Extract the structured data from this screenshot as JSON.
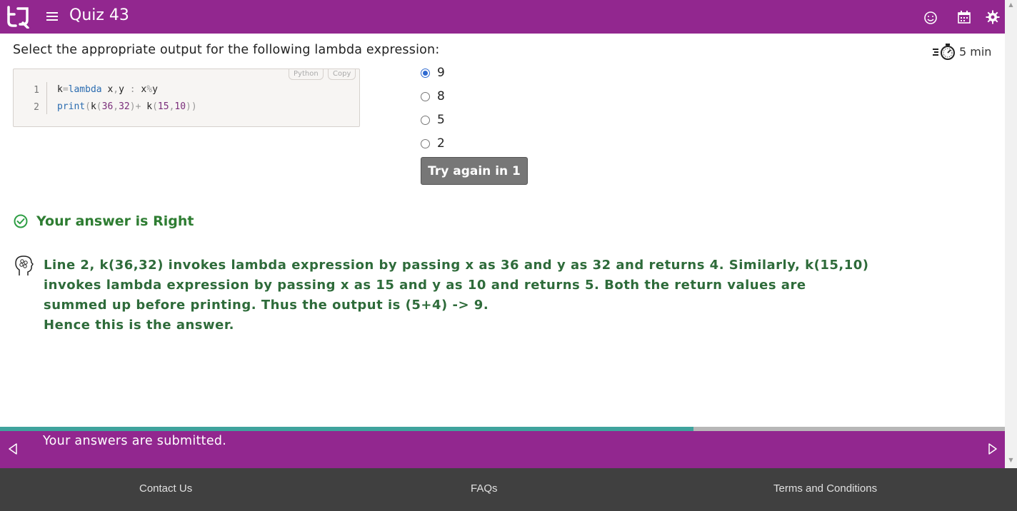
{
  "header": {
    "title": "Quiz 43",
    "icons": [
      "logo-icon",
      "menu-icon",
      "smiley-icon",
      "calendar-icon",
      "settings-icon"
    ]
  },
  "question": {
    "text": "Select the appropriate output for the following lambda expression:",
    "timer": "5 min"
  },
  "code": {
    "language_label": "Python",
    "copy_label": "Copy",
    "line_numbers": [
      "1",
      "2"
    ]
  },
  "options": [
    {
      "label": "9",
      "selected": true
    },
    {
      "label": "8",
      "selected": false
    },
    {
      "label": "5",
      "selected": false
    },
    {
      "label": "2",
      "selected": false
    }
  ],
  "try_again_label": "Try again in 1",
  "result_text": "Your answer is Right",
  "explanation": {
    "line1": "Line 2, k(36,32) invokes lambda expression by passing x as 36 and y as 32 and returns 4. Similarly, k(15,10) invokes lambda expression by passing x as 15 and y as 10 and returns 5. Both the return values are summed up before printing. Thus the output is (5+4) -> 9.",
    "line2": "Hence this is the answer."
  },
  "progress": {
    "fraction": 0.69
  },
  "status_bar": {
    "message": "Your answers are submitted."
  },
  "footer": {
    "contact": "Contact Us",
    "faqs": "FAQs",
    "terms": "Terms and Conditions"
  },
  "colors": {
    "brand": "#92278f",
    "success": "#2e7d32",
    "progress": "#3fa39d"
  }
}
